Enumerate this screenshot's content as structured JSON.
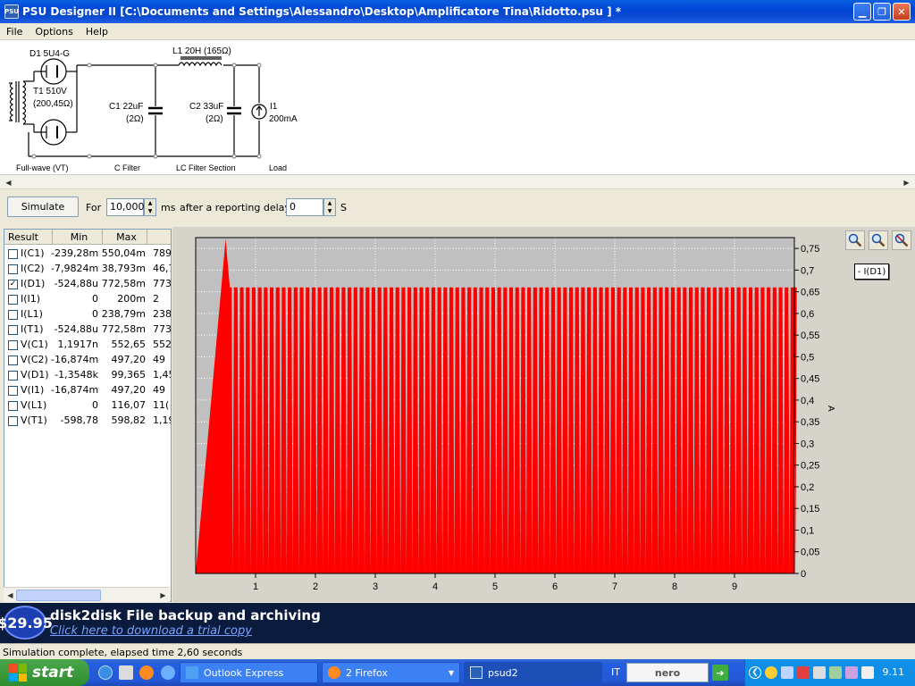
{
  "window": {
    "title": "PSU Designer II  [C:\\Documents and Settings\\Alessandro\\Desktop\\Amplificatore Tina\\Ridotto.psu ] *",
    "app_icon_text": "PSU"
  },
  "menu": [
    "File",
    "Options",
    "Help"
  ],
  "schematic": {
    "d1": "D1 5U4-G",
    "l1": "L1 20H (165Ω)",
    "t1_a": "T1 510V",
    "t1_b": "(200,45Ω)",
    "c1_a": "C1 22uF",
    "c1_b": "(2Ω)",
    "c2_a": "C2 33uF",
    "c2_b": "(2Ω)",
    "i1_a": "I1",
    "i1_b": "200mA",
    "sec_fullwave": "Full-wave (VT)",
    "sec_cfilter": "C Filter",
    "sec_lcfilter": "LC Filter Section",
    "sec_load": "Load"
  },
  "controls": {
    "simulate": "Simulate",
    "for": "For",
    "duration": "10,000",
    "ms": "ms",
    "after": "after a reporting delay of",
    "delay": "0",
    "s": "S"
  },
  "results": {
    "headers": [
      "Result",
      "Min",
      "Max"
    ],
    "rows": [
      {
        "checked": false,
        "name": "I(C1)",
        "min": "-239,28m",
        "max": "550,04m",
        "ext": "789,"
      },
      {
        "checked": false,
        "name": "I(C2)",
        "min": "-7,9824m",
        "max": "38,793m",
        "ext": "46,7"
      },
      {
        "checked": true,
        "name": "I(D1)",
        "min": "-524,88u",
        "max": "772,58m",
        "ext": "773,"
      },
      {
        "checked": false,
        "name": "I(I1)",
        "min": "0",
        "max": "200m",
        "ext": "2"
      },
      {
        "checked": false,
        "name": "I(L1)",
        "min": "0",
        "max": "238,79m",
        "ext": "238,"
      },
      {
        "checked": false,
        "name": "I(T1)",
        "min": "-524,88u",
        "max": "772,58m",
        "ext": "773,"
      },
      {
        "checked": false,
        "name": "V(C1)",
        "min": "1,1917n",
        "max": "552,65",
        "ext": "552"
      },
      {
        "checked": false,
        "name": "V(C2)",
        "min": "-16,874m",
        "max": "497,20",
        "ext": "49"
      },
      {
        "checked": false,
        "name": "V(D1)",
        "min": "-1,3548k",
        "max": "99,365",
        "ext": "1,45"
      },
      {
        "checked": false,
        "name": "V(I1)",
        "min": "-16,874m",
        "max": "497,20",
        "ext": "49"
      },
      {
        "checked": false,
        "name": "V(L1)",
        "min": "0",
        "max": "116,07",
        "ext": "11("
      },
      {
        "checked": false,
        "name": "V(T1)",
        "min": "-598,78",
        "max": "598,82",
        "ext": "1,19"
      }
    ]
  },
  "chart_data": {
    "type": "area",
    "series": [
      {
        "name": "- I(D1)",
        "color": "#ff0000"
      }
    ],
    "y_ticks": [
      "0",
      "0,05",
      "0,1",
      "0,15",
      "0,2",
      "0,25",
      "0,3",
      "0,35",
      "0,4",
      "0,45",
      "0,5",
      "0,55",
      "0,6",
      "0,65",
      "0,7",
      "0,75"
    ],
    "x_ticks": [
      "1",
      "2",
      "3",
      "4",
      "5",
      "6",
      "7",
      "8",
      "9"
    ],
    "ylabel": "A",
    "xlim": [
      0,
      10
    ],
    "ylim": [
      0,
      0.775
    ],
    "startup_peak": {
      "x": 0.5,
      "y": 0.772
    },
    "steady_peak": 0.66,
    "pulse_period": 0.1,
    "grid": true,
    "legend_placement": "top-right",
    "bg_color": "#c0c0c0"
  },
  "banner": {
    "price": "$29.95",
    "title": "disk2disk File backup and archiving",
    "link": "Click here to download a trial copy"
  },
  "status": "Simulation complete, elapsed time 2,60 seconds",
  "taskbar": {
    "start": "start",
    "tasks": [
      "Outlook Express",
      "2 Firefox",
      "psud2"
    ],
    "lang": "IT",
    "nero": "nero",
    "time": "9.11"
  }
}
